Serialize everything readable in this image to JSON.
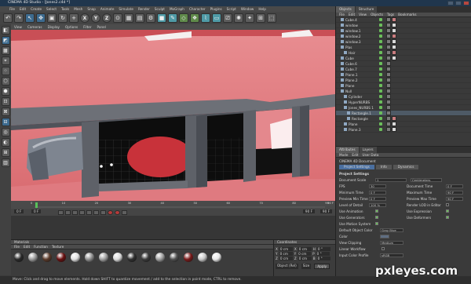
{
  "window": {
    "title": "CINEMA 4D Studio - [Jones2.c4d *]"
  },
  "menu": [
    "File",
    "Edit",
    "Create",
    "Select",
    "Tools",
    "Mesh",
    "Snap",
    "Animate",
    "Simulate",
    "Render",
    "Sculpt",
    "MoGraph",
    "Character",
    "Plugins",
    "Script",
    "Window",
    "Help"
  ],
  "toolbar": {
    "axis_labels": [
      "X",
      "Y",
      "Z"
    ]
  },
  "viewport": {
    "menu": [
      "View",
      "Cameras",
      "Display",
      "Options",
      "Filter",
      "Panel"
    ]
  },
  "timeline": {
    "ticks": [
      "0",
      "10",
      "20",
      "30",
      "40",
      "50",
      "60",
      "70",
      "80",
      "90"
    ],
    "frame": "0 F",
    "end": "90 F",
    "frame_fields": [
      "0 F",
      "0 F",
      "90 F",
      "90 F"
    ]
  },
  "materials": {
    "title": "Materials",
    "menu": [
      "File",
      "Edit",
      "Function",
      "Texture"
    ],
    "balls": [
      "#2a2a2a",
      "#9a9a9a",
      "#5a3a2a",
      "#6a1010",
      "#e0e0e0",
      "#909090",
      "#a0a0a0",
      "#dcdcdc",
      "#303030",
      "#3a3a3a",
      "#a0a0a0",
      "#505050",
      "#7a1a1a",
      "#c8c8c8",
      "#e8e8e8"
    ]
  },
  "coordinates": {
    "title": "Coordinates",
    "rows": [
      [
        "X",
        "0 cm",
        "X",
        "0 cm",
        "H",
        "0 °"
      ],
      [
        "Y",
        "0 cm",
        "Y",
        "0 cm",
        "P",
        "0 °"
      ],
      [
        "Z",
        "0 cm",
        "Z",
        "0 cm",
        "B",
        "0 °"
      ]
    ],
    "mode": "Object (Rel)",
    "size": "Size",
    "apply": "Apply"
  },
  "objects": {
    "tabs": [
      "Objects",
      "Structure"
    ],
    "menu": [
      "File",
      "Edit",
      "View",
      "Objects",
      "Tags",
      "Bookmarks"
    ],
    "rows": [
      "Cube.4",
      "window",
      "window.1",
      "window.2",
      "window.3",
      "Plas",
      "Hair",
      "Cube",
      "Cube.6",
      "Cube.7",
      "Plane.1",
      "Plane.2",
      "Plane",
      "Null",
      "Cylinder",
      "HyperNURBS",
      "Jones_NURBS 1",
      "Rectangle.1",
      "Rectangle",
      "Plane",
      "Plane.3"
    ]
  },
  "attributes": {
    "tabs": [
      "Attributes",
      "Layers"
    ],
    "menu": [
      "Mode",
      "Edit",
      "User Data"
    ],
    "doc": "CINEMA 4D Document",
    "subtabs": [
      "Project Settings",
      "Info",
      "Dynamics"
    ],
    "section": "Project Settings",
    "scale_label": "Document Scale",
    "scale_val": "1",
    "scale_unit": "Centimeters",
    "grid": [
      [
        "FPS",
        "30",
        "Document Time",
        "0 F"
      ],
      [
        "Minimum Time",
        "0 F",
        "Maximum Time",
        "90 F"
      ],
      [
        "Preview Min Time",
        "0 F",
        "Preview Max Time",
        "90 F"
      ],
      [
        "Level of Detail",
        "100 %",
        "Render LOD in Editor",
        ""
      ]
    ],
    "checks": [
      [
        "Use Animation",
        "Use Expression"
      ],
      [
        "Use Generators",
        "Use Deformers"
      ],
      [
        "Use Motion System",
        ""
      ]
    ],
    "color_label": "Default Object Color",
    "color_val": "Gray Blue",
    "color2": "Color",
    "view_clip": "View Clipping",
    "view_clip_val": "Medium",
    "linear": "Linear Workflow",
    "icp": "Input Color Profile",
    "icp_val": "sRGB"
  },
  "status": "Move: Click and drag to move elements. Hold down SHIFT to quantize movement / add to the selection in point mode, CTRL to remove.",
  "watermark": "pxleyes.com"
}
